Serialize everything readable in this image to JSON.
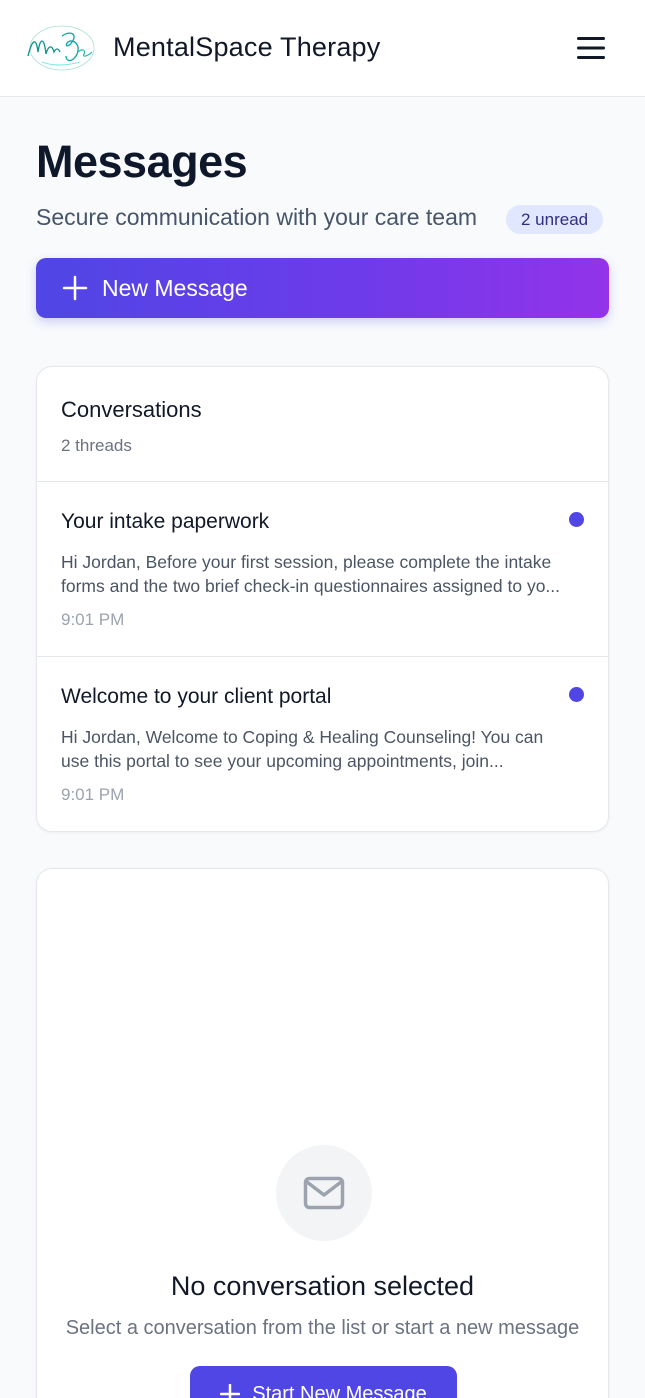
{
  "app": {
    "name": "MentalSpace Therapy",
    "logo_text": "MentalSpace"
  },
  "header": {
    "menu_icon": "hamburger-menu-icon"
  },
  "page": {
    "title": "Messages",
    "subtitle": "Secure communication with your care team",
    "unread_badge": "2 unread",
    "new_message_label": "New Message"
  },
  "conversations": {
    "title": "Conversations",
    "count_label": "2 threads",
    "threads": [
      {
        "subject": "Your intake paperwork",
        "preview_line1": "Hi Jordan, Before your first session, please complete the intake",
        "preview_line2": "forms and the two brief check-in questionnaires assigned to yo...",
        "time": "9:01 PM",
        "unread": true
      },
      {
        "subject": "Welcome to your client portal",
        "preview_line1": "Hi Jordan, Welcome to Coping & Healing Counseling! You can",
        "preview_line2": "use this portal to see your upcoming appointments, join...",
        "time": "9:01 PM",
        "unread": true
      }
    ]
  },
  "detail": {
    "empty_icon": "mail-icon",
    "empty_title": "No conversation selected",
    "empty_subtitle": "Select a conversation from the list or start a new message",
    "start_button_label": "Start New Message"
  },
  "colors": {
    "accent": "#4f46e5",
    "gradient_end": "#9333ea",
    "badge_bg": "#e0e7ff",
    "unread_dot": "#4f46e5"
  }
}
